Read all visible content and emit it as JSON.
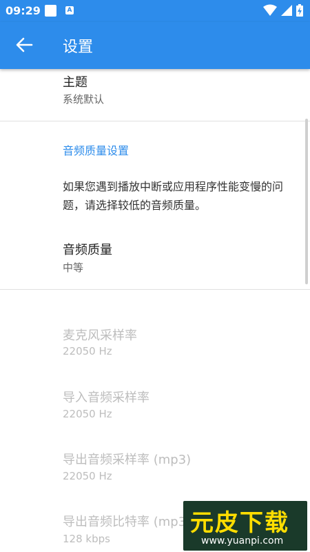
{
  "status_bar": {
    "time": "09:29",
    "badge_letter": "A",
    "icons": [
      "notification-square-icon",
      "a-notification-icon",
      "wifi-icon",
      "cell-signal-icon",
      "battery-charging-icon"
    ]
  },
  "app_bar": {
    "back_icon": "arrow-left-icon",
    "title": "设置"
  },
  "settings": {
    "theme": {
      "title": "主题",
      "summary": "系统默认"
    },
    "audio_quality_section": {
      "header": "音频质量设置",
      "description": "如果您遇到播放中断或应用程序性能变慢的问题，请选择较低的音频质量。",
      "quality": {
        "title": "音频质量",
        "summary": "中等"
      }
    },
    "mic_sample_rate": {
      "title": "麦克风采样率",
      "summary": "22050 Hz",
      "enabled": false
    },
    "import_sample_rate": {
      "title": "导入音频采样率",
      "summary": "22050 Hz",
      "enabled": false
    },
    "export_sample_rate": {
      "title": "导出音频采样率 (mp3)",
      "summary": "22050 Hz",
      "enabled": false
    },
    "export_bitrate": {
      "title": "导出音频比特率 (mp3)",
      "summary": "128 kbps",
      "enabled": false
    }
  },
  "watermark": {
    "text": "元皮下载",
    "url": "www.yuanpi.com"
  },
  "colors": {
    "primary": "#2d8ceb",
    "accent": "#2d8ceb",
    "disabled_text": "#bdbdbd"
  }
}
